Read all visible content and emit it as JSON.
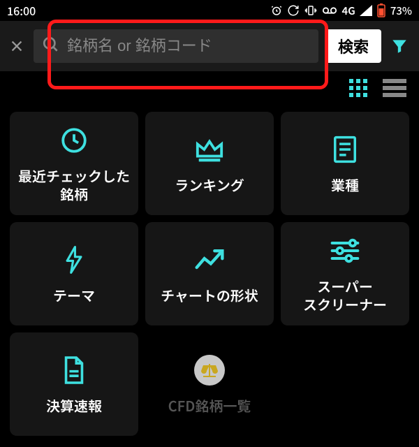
{
  "status": {
    "time": "16:00",
    "network": "4G",
    "battery": "73%"
  },
  "search": {
    "placeholder": "銘柄名 or 銘柄コード",
    "button": "検索"
  },
  "grid": {
    "items": [
      {
        "label": "最近チェックした\n銘柄"
      },
      {
        "label": "ランキング"
      },
      {
        "label": "業種"
      },
      {
        "label": "テーマ"
      },
      {
        "label": "チャートの形状"
      },
      {
        "label": "スーパー\nスクリーナー"
      },
      {
        "label": "決算速報"
      },
      {
        "label": "CFD銘柄一覧"
      }
    ]
  },
  "colors": {
    "accent": "#3ee0e0",
    "highlight": "#ff1a1a"
  }
}
